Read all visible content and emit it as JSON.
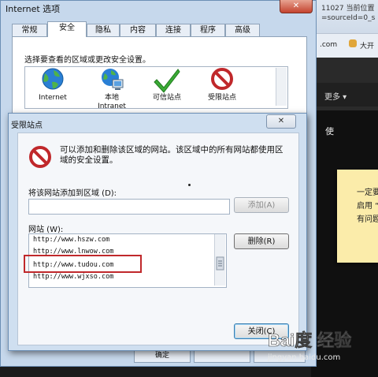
{
  "background_browser": {
    "url_top": "11027 当前位置",
    "url_param": "=sourceId=0_s",
    "com_text": ".com",
    "tab_label": "大开",
    "more_label": "更多 ▾",
    "side_text": "使",
    "note_lines": [
      "一定要",
      "启用 “",
      "有问题"
    ]
  },
  "main_dialog": {
    "title": "Internet 选项",
    "close_label": "✕",
    "tabs": [
      "常规",
      "安全",
      "隐私",
      "内容",
      "连接",
      "程序",
      "高级"
    ],
    "active_tab": "安全",
    "zone_prompt": "选择要查看的区域或更改安全设置。",
    "zones": [
      {
        "label_line1": "Internet",
        "label_line2": "",
        "icon": "globe-icon"
      },
      {
        "label_line1": "本地",
        "label_line2": "Intranet",
        "icon": "local-intranet-icon"
      },
      {
        "label_line1": "可信站点",
        "label_line2": "",
        "icon": "checkmark-icon"
      },
      {
        "label_line1": "受限站点",
        "label_line2": "",
        "icon": "restricted-icon"
      }
    ],
    "bottom_button_1": "确定"
  },
  "restricted_dialog": {
    "title": "受限站点",
    "close_label": "✕",
    "warning_text": "可以添加和删除该区域的网站。该区域中的所有网站都使用区域的安全设置。",
    "add_label": "将该网站添加到区域 (D):",
    "add_input_value": "",
    "add_button": "添加(A)",
    "sites_label": "网站 (W):",
    "sites": [
      "http://www.hszw.com",
      "http://www.lnwow.com",
      "http://www.tudou.com",
      "http://www.wjxso.com"
    ],
    "highlighted_site": "http://www.tudou.com",
    "remove_button": "删除(R)",
    "close_button": "关闭(C)",
    "colors": {
      "highlight": "#c0282b",
      "restricted_icon": "#c0282b"
    }
  },
  "watermark": {
    "text": "Bai度 经验",
    "subtext": "jingyan.baidu.com"
  }
}
